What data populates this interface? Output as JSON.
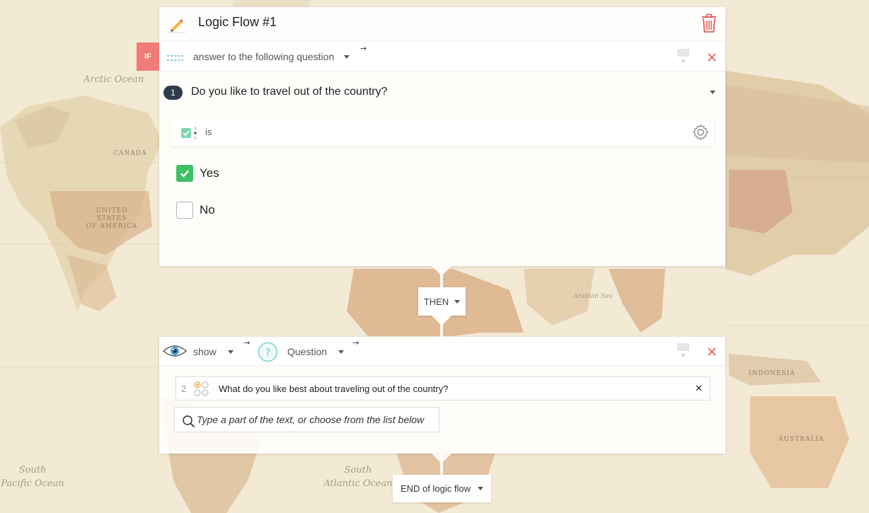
{
  "map": {
    "oceans": [
      "Arctic Ocean",
      "South Pacific Ocean",
      "South Atlantic Ocean"
    ],
    "pacific_word_1": "South",
    "pacific_word_2": "Pacific Ocean",
    "atlantic_word_1": "South",
    "atlantic_word_2": "Atlantic Ocean",
    "usa_line_1": "UNITED STATES",
    "usa_line_2": "OF AMERICA",
    "canada": "CANADA",
    "australia": "AUSTRALIA",
    "indonesia": "INDONESIA",
    "arabian_sea": "Arabian Sea"
  },
  "flow": {
    "title": "Logic Flow #1",
    "if_label": "IF",
    "condition_type": "answer to the following question",
    "question_number": "1",
    "question_text": "Do you like to travel out of the country?",
    "operator": "is",
    "answers": [
      {
        "label": "Yes",
        "checked": true
      },
      {
        "label": "No",
        "checked": false
      }
    ]
  },
  "then_label": "THEN",
  "action": {
    "verb": "show",
    "target_type": "Question",
    "target_question_number": "2",
    "target_question_text": "What do you like best about traveling out of the country?",
    "remove_symbol": "✕",
    "search_placeholder": "Type a part of the text, or choose from the list below"
  },
  "end_label": "END of logic flow",
  "colors": {
    "if_badge": "#f07b78",
    "delete_red": "#e65a55",
    "check_green": "#3fc065",
    "question_badge": "#2f3b4a",
    "accent_teal": "#5fcfc4"
  }
}
